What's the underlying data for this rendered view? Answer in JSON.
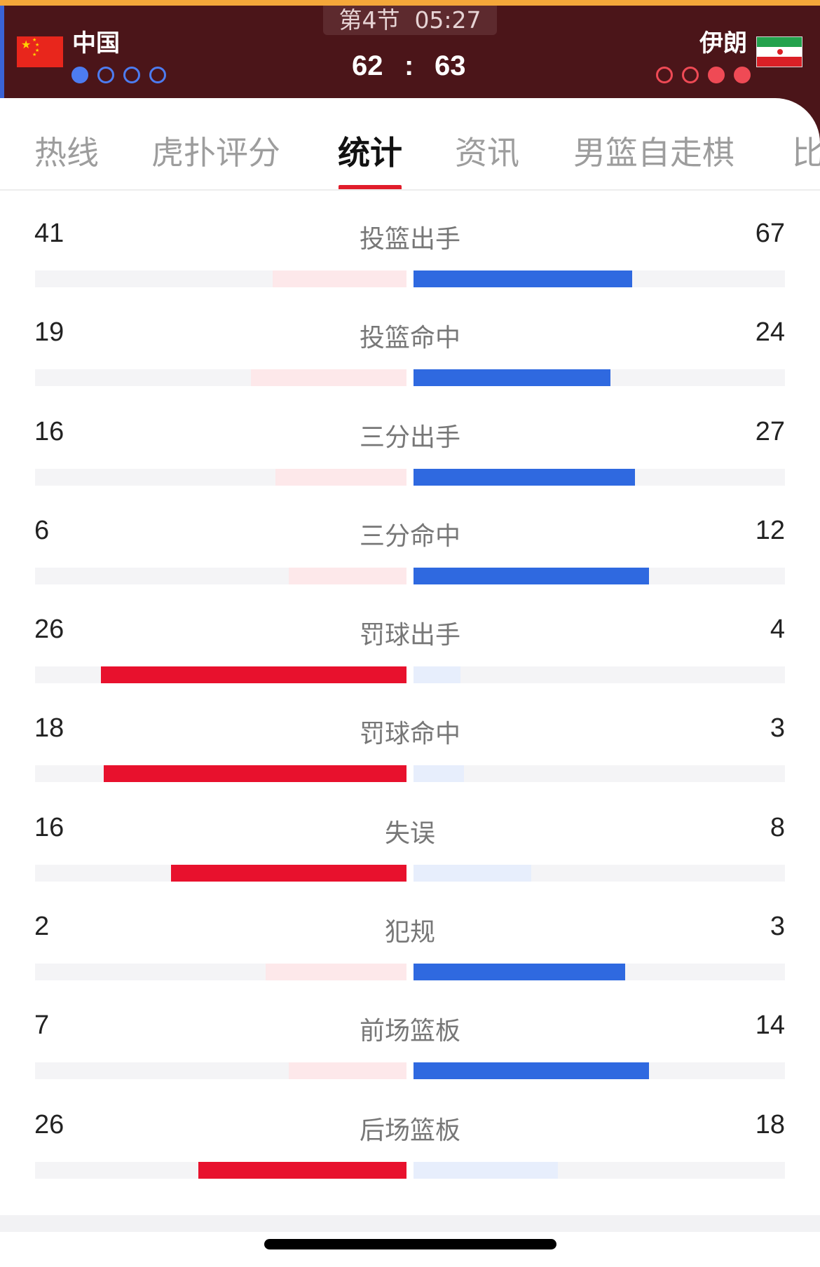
{
  "match": {
    "period": "第4节",
    "clock": "05:27",
    "home_team": "中国",
    "away_team": "伊朗",
    "home_score": "62",
    "score_separator": ":",
    "away_score": "63",
    "home_timeouts": [
      true,
      false,
      false,
      false
    ],
    "away_timeouts": [
      false,
      false,
      true,
      true
    ],
    "colors": {
      "header_bg": "#4b1519",
      "home_accent": "#4d7cf0",
      "away_accent": "#ef4a55"
    }
  },
  "tabs": [
    {
      "label": "热线",
      "active": false
    },
    {
      "label": "虎扑评分",
      "active": false
    },
    {
      "label": "统计",
      "active": true
    },
    {
      "label": "资讯",
      "active": false
    },
    {
      "label": "男篮自走棋",
      "active": false
    },
    {
      "label": "比",
      "active": false
    }
  ],
  "stats": [
    {
      "label": "投篮出手",
      "home": 41,
      "away": 67
    },
    {
      "label": "投篮命中",
      "home": 19,
      "away": 24
    },
    {
      "label": "三分出手",
      "home": 16,
      "away": 27
    },
    {
      "label": "三分命中",
      "home": 6,
      "away": 12
    },
    {
      "label": "罚球出手",
      "home": 26,
      "away": 4
    },
    {
      "label": "罚球命中",
      "home": 18,
      "away": 3
    },
    {
      "label": "失误",
      "home": 16,
      "away": 8
    },
    {
      "label": "犯规",
      "home": 2,
      "away": 3
    },
    {
      "label": "前场篮板",
      "home": 7,
      "away": 14
    },
    {
      "label": "后场篮板",
      "home": 26,
      "away": 18
    }
  ],
  "bar_colors": {
    "home_strong": "#e8112d",
    "home_weak": "#fde8ea",
    "away_strong": "#2f69e0",
    "away_weak": "#e7eefc"
  }
}
